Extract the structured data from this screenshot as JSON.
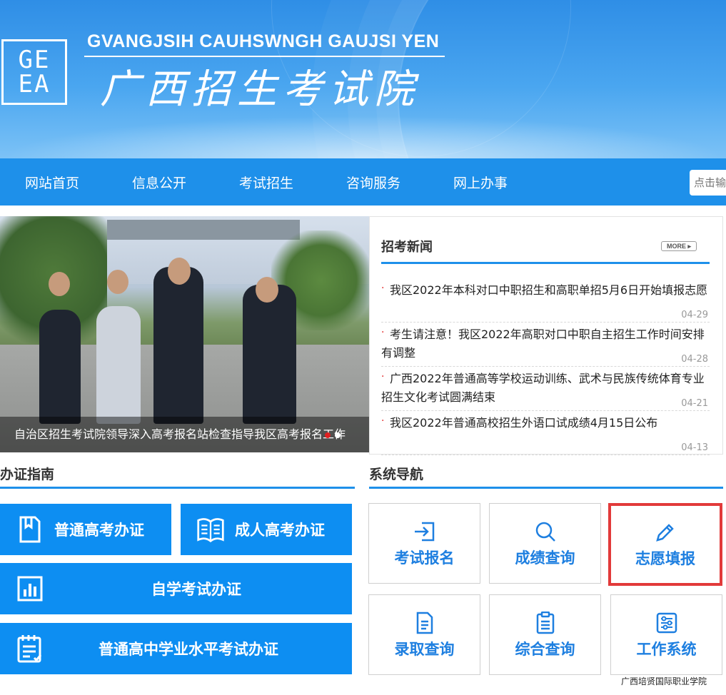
{
  "header": {
    "logo_text": [
      "GE",
      "EA"
    ],
    "site_name_en": "GVANGJSIH CAUHSWNGH GAUJSI YEN",
    "site_name_zh": "广西招生考试院"
  },
  "nav": {
    "items": [
      "网站首页",
      "信息公开",
      "考试招生",
      "咨询服务",
      "网上办事"
    ],
    "search_placeholder": "点击输"
  },
  "slider": {
    "caption": "自治区招生考试院领导深入高考报名站检查指导我区高考报名工作"
  },
  "news": {
    "title": "招考新闻",
    "more_label": "MORE",
    "items": [
      {
        "text": "我区2022年本科对口中职招生和高职单招5月6日开始填报志愿",
        "date": "04-29"
      },
      {
        "text": "考生请注意！我区2022年高职对口中职自主招生工作时间安排有调整",
        "date": "04-28"
      },
      {
        "text": "广西2022年普通高等学校运动训练、武术与民族传统体育专业招生文化考试圆满结束",
        "date": "04-21"
      },
      {
        "text": "我区2022年普通高校招生外语口试成绩4月15日公布",
        "date": "04-13"
      }
    ]
  },
  "guide": {
    "title": "办证指南",
    "buttons": [
      "普通高考办证",
      "成人高考办证",
      "自学考试办证",
      "普通高中学业水平考试办证"
    ]
  },
  "system_nav": {
    "title": "系统导航",
    "tiles": [
      {
        "label": "考试报名",
        "icon": "login-icon"
      },
      {
        "label": "成绩查询",
        "icon": "search-icon"
      },
      {
        "label": "志愿填报",
        "icon": "pencil-icon"
      },
      {
        "label": "录取查询",
        "icon": "document-icon"
      },
      {
        "label": "综合查询",
        "icon": "clipboard-icon"
      },
      {
        "label": "工作系统",
        "icon": "settings-sliders-icon"
      }
    ]
  },
  "watermark": "广西培贤国际职业学院",
  "colors": {
    "primary_blue": "#1e90ea",
    "button_blue": "#0d8ef2",
    "highlight_red": "#e23a3a",
    "tile_text": "#1e7fe0"
  }
}
